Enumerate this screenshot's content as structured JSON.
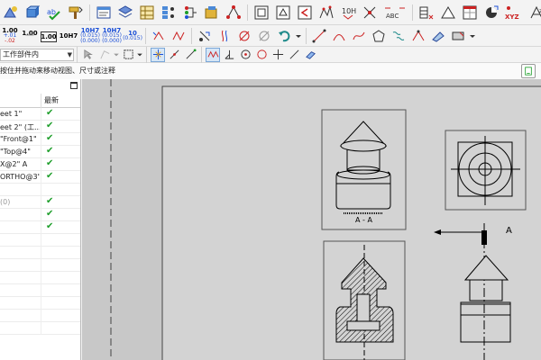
{
  "toolbar_row1": {
    "icons": [
      "smart-dimension-icon",
      "model-items-icon",
      "spell-check-icon",
      "format-painter-icon",
      "note-icon",
      "balloon-icon",
      "auto-balloon-icon",
      "magnetic-line-icon",
      "surface-finish-icon",
      "weld-symbol-icon",
      "hole-callout-icon",
      "geometric-tolerance-icon",
      "datum-feature-icon",
      "datum-target-icon",
      "blocks-icon",
      "center-mark-icon",
      "centerline-icon",
      "area-hatch-icon",
      "tables-icon",
      "revision-symbol-icon",
      "dimension-xpert-icon",
      "ordinate-dimension-icon",
      "triangle-icon",
      "grid-icon",
      "point-icon",
      "xyz-coordinate-icon",
      "sort-icon"
    ],
    "xyz_label": "XYZ",
    "abc_label": "ABC",
    "h10h7_label": "10H7"
  },
  "toolbar_row2": {
    "tolerance_buttons": [
      {
        "top": "1.00",
        "mid": "+.01",
        "bot": "-.02"
      },
      {
        "top": "1.00",
        "mid": "",
        "bot": ""
      },
      {
        "top": "1.00",
        "mid": "",
        "bot": ""
      },
      {
        "top": "10H7",
        "mid": "",
        "bot": ""
      },
      {
        "top": "10H7",
        "mid": "(0.015)",
        "bot": "(0.000)"
      },
      {
        "top": "10H7",
        "mid": "(0.015)",
        "bot": "(0.000)"
      },
      {
        "top": "10",
        "mid": "(0.015)",
        "bot": ""
      }
    ],
    "icons": [
      "add-parenthesis-icon",
      "center-dimension-icon",
      "offset-text-icon",
      "inspection-dimension-icon",
      "diameter-icon",
      "ref-diameter-icon",
      "undo-arrow-icon",
      "line-icon",
      "arc-icon",
      "spline-icon",
      "polygon-icon",
      "chain-icon",
      "snap-icon",
      "fillet-icon",
      "chamfer-icon",
      "more-icon"
    ]
  },
  "toolbar_row3": {
    "combo_value": "工作部件内",
    "icons": [
      "select-icon",
      "sketch-icon",
      "dropdown-icon",
      "box-select-icon",
      "dropdown-icon",
      "grid-snap-icon",
      "line-snap-icon",
      "tangent-icon",
      "spline-snap-icon",
      "perpendicular-icon",
      "center-snap-icon",
      "point-snap-icon",
      "intersect-icon",
      "angle-icon",
      "quick-snap-icon"
    ]
  },
  "status": {
    "text": "按住并拖动来移动视图、尺寸或注释"
  },
  "panel": {
    "header_latest": "最新",
    "rows": [
      {
        "name": "eet 1\"",
        "check": true,
        "grey": false
      },
      {
        "name": "eet 2\" (工...",
        "check": true,
        "grey": false
      },
      {
        "name": "\"Front@1\"",
        "check": true,
        "grey": false
      },
      {
        "name": "\"Top@4\"",
        "check": true,
        "grey": false
      },
      {
        "name": "X@2\" A",
        "check": true,
        "grey": false
      },
      {
        "name": "ORTHO@3\"",
        "check": true,
        "grey": false
      },
      {
        "name": "",
        "check": false,
        "grey": false
      },
      {
        "name": "(0)",
        "check": true,
        "grey": true
      },
      {
        "name": "",
        "check": true,
        "grey": false
      },
      {
        "name": "",
        "check": true,
        "grey": false
      },
      {
        "name": "",
        "check": false,
        "grey": false
      },
      {
        "name": "",
        "check": false,
        "grey": false
      },
      {
        "name": "",
        "check": false,
        "grey": false
      },
      {
        "name": "",
        "check": false,
        "grey": false
      },
      {
        "name": "",
        "check": false,
        "grey": false
      },
      {
        "name": "",
        "check": false,
        "grey": false
      },
      {
        "name": "",
        "check": false,
        "grey": false
      },
      {
        "name": "",
        "check": false,
        "grey": false
      }
    ]
  },
  "drawing": {
    "section_label_aa": "A - A",
    "section_arrow_label": "A"
  },
  "colors": {
    "check": "#1e9e2a",
    "canvas_bg": "#c8c8c8",
    "sheet_bg": "#d3d3d3",
    "tol_blue": "#1b4fd6",
    "tol_red": "#c22"
  }
}
